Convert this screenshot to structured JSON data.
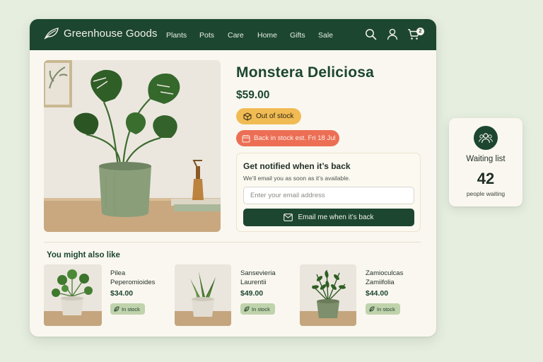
{
  "header": {
    "brand": "Greenhouse Goods",
    "nav": [
      "Plants",
      "Pots",
      "Care",
      "Home",
      "Gifts",
      "Sale"
    ],
    "icons": [
      "search-icon",
      "user-icon",
      "cart-icon",
      "leaf-logo-icon"
    ],
    "cart_count": "2"
  },
  "product": {
    "title": "Monstera Deliciosa",
    "price": "$59.00",
    "stock_status": "Out of stock",
    "back_in_stock": "Back in stock est. Fri 18 Jul"
  },
  "notify": {
    "title": "Get notified when it’s back",
    "subtitle": "We’ll email you as soon as it’s available.",
    "email_placeholder": "Enter your email address",
    "button_label": "Email me when it’s back"
  },
  "recommendations": {
    "heading": "You might also like",
    "items": [
      {
        "name_line1": "Pilea",
        "name_line2": "Peperomioides",
        "price": "$34.00",
        "stock": "In stock"
      },
      {
        "name_line1": "Sansevieria",
        "name_line2": "Laurentii",
        "price": "$49.00",
        "stock": "In stock"
      },
      {
        "name_line1": "Zamioculcas",
        "name_line2": "Zamiifolia",
        "price": "$44.00",
        "stock": "In stock"
      }
    ]
  },
  "waiting_list": {
    "title": "Waiting list",
    "count": "42",
    "subtitle": "people waiting"
  },
  "colors": {
    "brand_green": "#1c4630",
    "background": "#e6eee0",
    "surface": "#faf7f0",
    "out_of_stock": "#f1bb54",
    "restock": "#ec6f55",
    "in_stock": "#bfd3ac"
  }
}
